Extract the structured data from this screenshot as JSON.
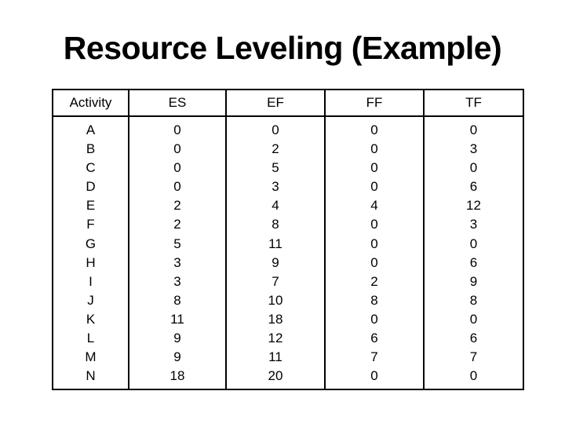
{
  "title": "Resource Leveling (Example)",
  "table": {
    "headers": [
      "Activity",
      "ES",
      "EF",
      "FF",
      "TF"
    ],
    "columns": {
      "activity": [
        "A",
        "B",
        "C",
        "D",
        "E",
        "F",
        "G",
        "H",
        "I",
        "J",
        "K",
        "L",
        "M",
        "N"
      ],
      "es": [
        "0",
        "0",
        "0",
        "0",
        "2",
        "2",
        "5",
        "3",
        "3",
        "8",
        "11",
        "9",
        "9",
        "18"
      ],
      "ef": [
        "0",
        "2",
        "5",
        "3",
        "4",
        "8",
        "11",
        "9",
        "7",
        "10",
        "18",
        "12",
        "11",
        "20"
      ],
      "ff": [
        "0",
        "0",
        "0",
        "0",
        "4",
        "0",
        "0",
        "0",
        "2",
        "8",
        "0",
        "6",
        "7",
        "0"
      ],
      "tf": [
        "0",
        "3",
        "0",
        "6",
        "12",
        "3",
        "0",
        "6",
        "9",
        "8",
        "0",
        "6",
        "7",
        "0"
      ]
    }
  }
}
